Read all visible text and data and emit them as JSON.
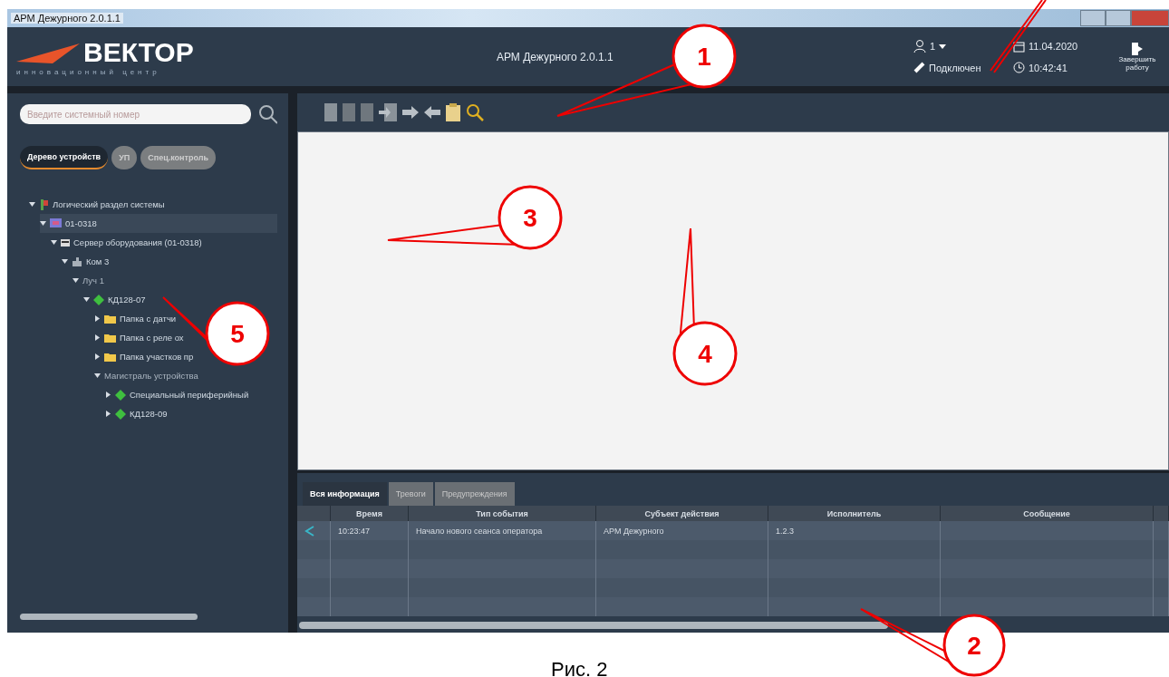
{
  "window": {
    "title": "АРМ Дежурного 2.0.1.1"
  },
  "header": {
    "logo": "ВЕКТОР",
    "logo_subtitle": "инновационный центр",
    "app_title": "АРМ Дежурного 2.0.1.1",
    "user": "1",
    "connection": "Подключен",
    "date": "11.04.2020",
    "time": "10:42:41",
    "exit_button": "Завершить работу"
  },
  "sidebar": {
    "search": {
      "placeholder": "Введите системный номер"
    },
    "tabs": [
      {
        "label": "Дерево устройств",
        "selected": true
      },
      {
        "label": "УП",
        "selected": false
      },
      {
        "label": "Спец.контроль",
        "selected": false
      }
    ],
    "tree": [
      {
        "label": "Логический раздел системы",
        "kind": "system",
        "expanded": true,
        "selected": false,
        "children": [
          {
            "label": "01-0318",
            "kind": "station",
            "expanded": true,
            "selected": true,
            "children": [
              {
                "label": "Сервер оборудования (01-0318)",
                "kind": "server",
                "expanded": true,
                "selected": false,
                "children": [
                  {
                    "label": "Ком 3",
                    "kind": "port",
                    "expanded": true,
                    "selected": false,
                    "children": [
                      {
                        "label": "Луч 1",
                        "kind": "line",
                        "expanded": true,
                        "selected": false,
                        "children": [
                          {
                            "label": "КД128-07",
                            "kind": "device",
                            "expanded": true,
                            "selected": false,
                            "children": [
                              {
                                "label": "Папка с датчи",
                                "kind": "folder",
                                "expanded": false,
                                "selected": false
                              },
                              {
                                "label": "Папка с реле ох",
                                "kind": "folder",
                                "expanded": false,
                                "selected": false
                              },
                              {
                                "label": "Папка участков пр",
                                "kind": "folder",
                                "expanded": false,
                                "selected": false
                              },
                              {
                                "label": "Магистраль устройства",
                                "kind": "line",
                                "expanded": true,
                                "selected": false,
                                "children": [
                                  {
                                    "label": "Специальный периферийный",
                                    "kind": "device",
                                    "expanded": false,
                                    "selected": false
                                  },
                                  {
                                    "label": "КД128-09",
                                    "kind": "device",
                                    "expanded": false,
                                    "selected": false
                                  }
                                ]
                              }
                            ]
                          }
                        ]
                      }
                    ]
                  }
                ]
              }
            ]
          }
        ]
      }
    ]
  },
  "events": {
    "tabs": [
      {
        "label": "Вся информация",
        "selected": true
      },
      {
        "label": "Тревоги",
        "selected": false
      },
      {
        "label": "Предупреждения",
        "selected": false
      }
    ],
    "columns": [
      "Время",
      "Тип события",
      "Субъект действия",
      "Исполнитель",
      "Сообщение"
    ],
    "rows": [
      {
        "time": "10:23:47",
        "type": "Начало нового сеанса оператора",
        "subject": "АРМ Дежурного",
        "performer": "1.2.3",
        "message": ""
      }
    ]
  },
  "callouts": [
    "1",
    "2",
    "3",
    "4",
    "5"
  ],
  "caption": "Рис. 2"
}
